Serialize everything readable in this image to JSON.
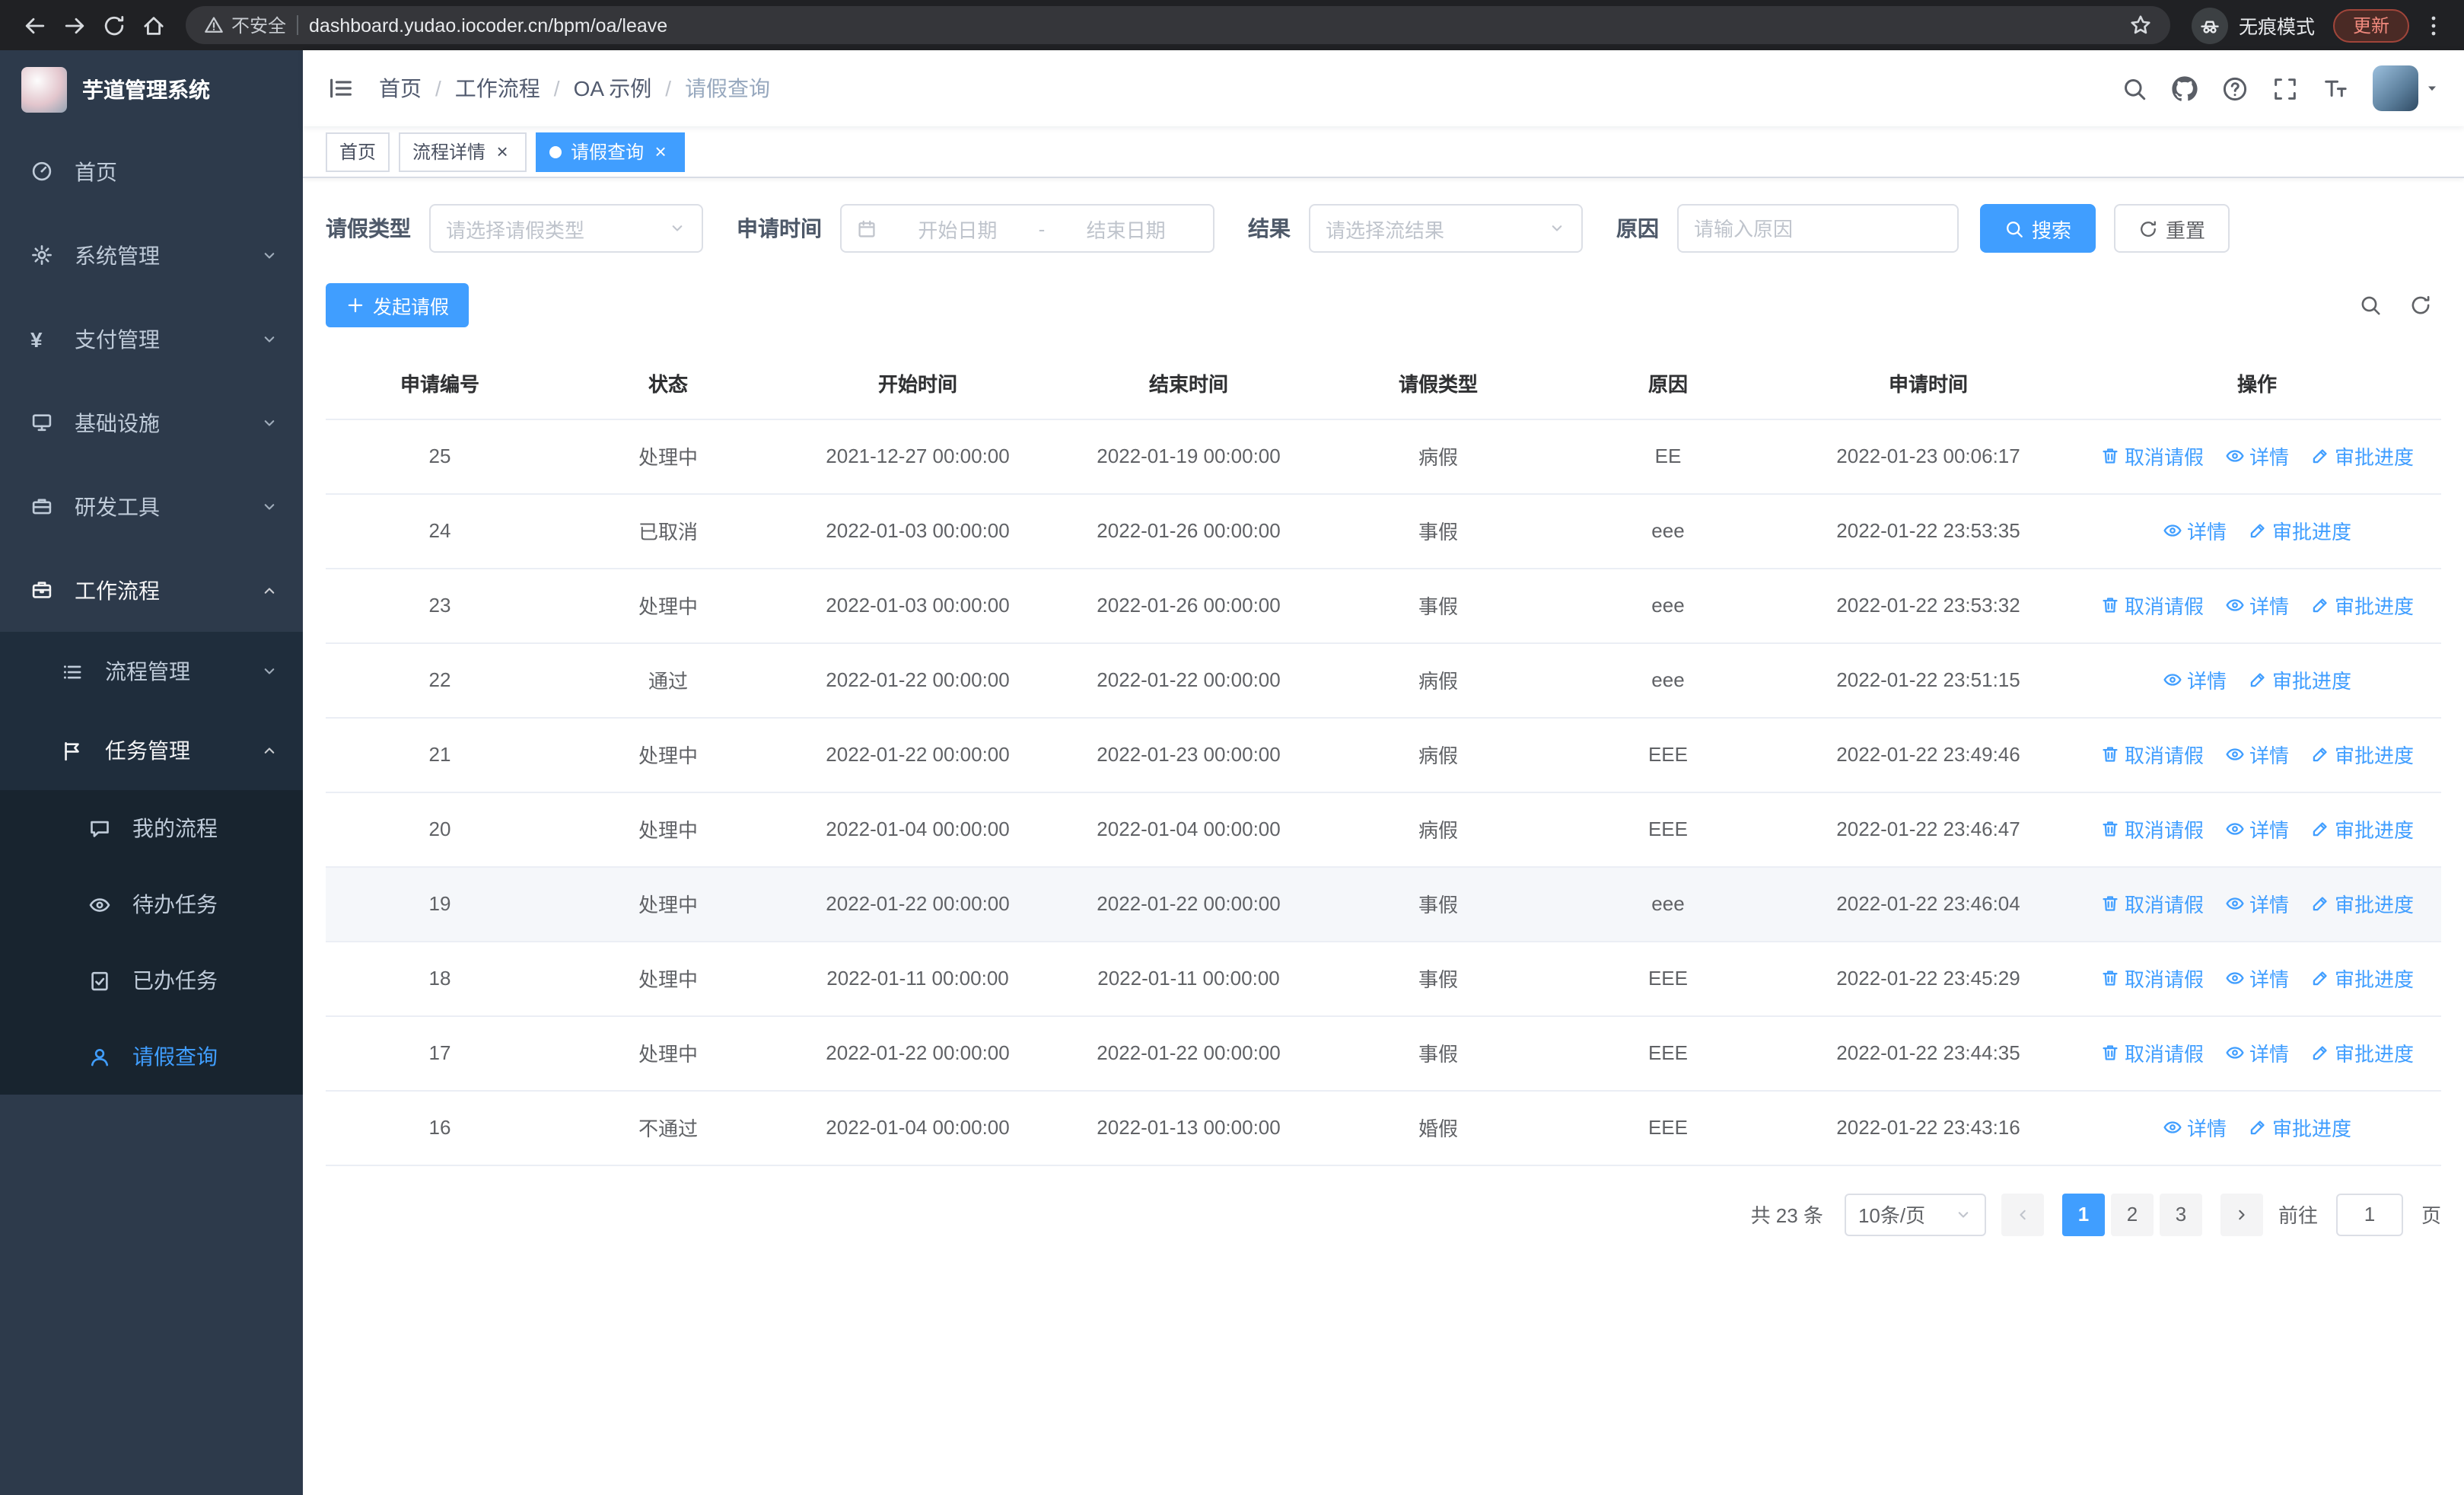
{
  "theme": {
    "accent": "#409eff",
    "sidebar_bg": "#2d3a4b",
    "sidebar_sub_bg": "#1f2d3c",
    "sidebar_deep_bg": "#18242f",
    "active_tag_bg": "#409eff",
    "table_hover_bg": "#f5f7fa"
  },
  "browser": {
    "security": "不安全",
    "url": "dashboard.yudao.iocoder.cn/bpm/oa/leave",
    "incognito": "无痕模式",
    "update": "更新"
  },
  "sidebar": {
    "logo_title": "芋道管理系统",
    "menu": [
      {
        "label": "首页",
        "icon": "dashboard",
        "level": 1
      },
      {
        "label": "系统管理",
        "icon": "gear",
        "level": 1,
        "chevron": "down"
      },
      {
        "label": "支付管理",
        "icon": "yen",
        "level": 1,
        "chevron": "down"
      },
      {
        "label": "基础设施",
        "icon": "monitor",
        "level": 1,
        "chevron": "down"
      },
      {
        "label": "研发工具",
        "icon": "toolbox",
        "level": 1,
        "chevron": "down"
      },
      {
        "label": "工作流程",
        "icon": "briefcase",
        "level": 1,
        "chevron": "up",
        "open": true
      },
      {
        "label": "流程管理",
        "icon": "list",
        "level": 2,
        "chevron": "down"
      },
      {
        "label": "任务管理",
        "icon": "flag",
        "level": 2,
        "chevron": "up",
        "open": true
      },
      {
        "label": "我的流程",
        "icon": "chat",
        "level": 3
      },
      {
        "label": "待办任务",
        "icon": "eye",
        "level": 3
      },
      {
        "label": "已办任务",
        "icon": "check",
        "level": 3
      },
      {
        "label": "请假查询",
        "icon": "user",
        "level": 3,
        "active": true
      }
    ]
  },
  "header": {
    "breadcrumb_separator": "/",
    "breadcrumb": [
      {
        "label": "首页"
      },
      {
        "label": "工作流程"
      },
      {
        "label": "OA 示例"
      },
      {
        "label": "请假查询",
        "current": true
      }
    ]
  },
  "tabs": [
    {
      "label": "首页",
      "closable": false,
      "active": false
    },
    {
      "label": "流程详情",
      "closable": true,
      "active": false
    },
    {
      "label": "请假查询",
      "closable": true,
      "active": true
    }
  ],
  "filters": {
    "leave_type_label": "请假类型",
    "leave_type_placeholder": "请选择请假类型",
    "apply_time_label": "申请时间",
    "start_date_placeholder": "开始日期",
    "date_separator": "-",
    "end_date_placeholder": "结束日期",
    "result_label": "结果",
    "result_placeholder": "请选择流结果",
    "reason_label": "原因",
    "reason_placeholder": "请输入原因",
    "search_label": "搜索",
    "reset_label": "重置"
  },
  "toolbar": {
    "create_label": "发起请假"
  },
  "table": {
    "columns": [
      "申请编号",
      "状态",
      "开始时间",
      "结束时间",
      "请假类型",
      "原因",
      "申请时间",
      "操作"
    ],
    "op_defs": {
      "cancel": {
        "label": "取消请假",
        "icon": "trash"
      },
      "detail": {
        "label": "详情",
        "icon": "eye"
      },
      "progress": {
        "label": "审批进度",
        "icon": "edit"
      }
    },
    "rows": [
      {
        "id": "25",
        "status": "处理中",
        "start": "2021-12-27 00:00:00",
        "end": "2022-01-19 00:00:00",
        "type": "病假",
        "reason": "EE",
        "applied": "2022-01-23 00:06:17",
        "ops": [
          "cancel",
          "detail",
          "progress"
        ]
      },
      {
        "id": "24",
        "status": "已取消",
        "start": "2022-01-03 00:00:00",
        "end": "2022-01-26 00:00:00",
        "type": "事假",
        "reason": "eee",
        "applied": "2022-01-22 23:53:35",
        "ops": [
          "detail",
          "progress"
        ]
      },
      {
        "id": "23",
        "status": "处理中",
        "start": "2022-01-03 00:00:00",
        "end": "2022-01-26 00:00:00",
        "type": "事假",
        "reason": "eee",
        "applied": "2022-01-22 23:53:32",
        "ops": [
          "cancel",
          "detail",
          "progress"
        ]
      },
      {
        "id": "22",
        "status": "通过",
        "start": "2022-01-22 00:00:00",
        "end": "2022-01-22 00:00:00",
        "type": "病假",
        "reason": "eee",
        "applied": "2022-01-22 23:51:15",
        "ops": [
          "detail",
          "progress"
        ]
      },
      {
        "id": "21",
        "status": "处理中",
        "start": "2022-01-22 00:00:00",
        "end": "2022-01-23 00:00:00",
        "type": "病假",
        "reason": "EEE",
        "applied": "2022-01-22 23:49:46",
        "ops": [
          "cancel",
          "detail",
          "progress"
        ]
      },
      {
        "id": "20",
        "status": "处理中",
        "start": "2022-01-04 00:00:00",
        "end": "2022-01-04 00:00:00",
        "type": "病假",
        "reason": "EEE",
        "applied": "2022-01-22 23:46:47",
        "ops": [
          "cancel",
          "detail",
          "progress"
        ]
      },
      {
        "id": "19",
        "status": "处理中",
        "start": "2022-01-22 00:00:00",
        "end": "2022-01-22 00:00:00",
        "type": "事假",
        "reason": "eee",
        "applied": "2022-01-22 23:46:04",
        "ops": [
          "cancel",
          "detail",
          "progress"
        ],
        "highlight": true
      },
      {
        "id": "18",
        "status": "处理中",
        "start": "2022-01-11 00:00:00",
        "end": "2022-01-11 00:00:00",
        "type": "事假",
        "reason": "EEE",
        "applied": "2022-01-22 23:45:29",
        "ops": [
          "cancel",
          "detail",
          "progress"
        ]
      },
      {
        "id": "17",
        "status": "处理中",
        "start": "2022-01-22 00:00:00",
        "end": "2022-01-22 00:00:00",
        "type": "事假",
        "reason": "EEE",
        "applied": "2022-01-22 23:44:35",
        "ops": [
          "cancel",
          "detail",
          "progress"
        ]
      },
      {
        "id": "16",
        "status": "不通过",
        "start": "2022-01-04 00:00:00",
        "end": "2022-01-13 00:00:00",
        "type": "婚假",
        "reason": "EEE",
        "applied": "2022-01-22 23:43:16",
        "ops": [
          "detail",
          "progress"
        ]
      }
    ]
  },
  "pagination": {
    "total": "共 23 条",
    "page_size": "10条/页",
    "pages": [
      "1",
      "2",
      "3"
    ],
    "active": "1",
    "goto_prefix": "前往",
    "goto_value": "1",
    "goto_suffix": "页"
  }
}
